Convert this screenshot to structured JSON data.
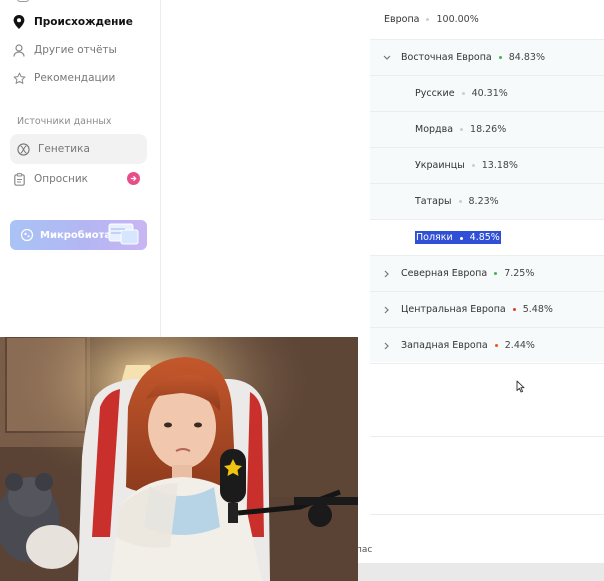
{
  "sidebar": {
    "nav": [
      {
        "label": "Происхождение",
        "icon": "map-pin-icon",
        "active": true
      },
      {
        "label": "Другие отчёты",
        "icon": "person-icon"
      },
      {
        "label": "Рекомендации",
        "icon": "star-icon"
      }
    ],
    "section_label": "Источники данных",
    "sources": [
      {
        "label": "Генетика",
        "icon": "dna-icon",
        "selected": true
      },
      {
        "label": "Опросник",
        "icon": "clipboard-icon"
      }
    ],
    "microbiota_label": "Микробиота"
  },
  "tree": {
    "root": {
      "label": "Европа",
      "value": "100.00%",
      "dot_color": "#cfcfcf"
    },
    "rows": [
      {
        "label": "Восточная Европа",
        "value": "84.83%",
        "dot_color": "#4caf50",
        "expanded": true,
        "level": 0
      },
      {
        "label": "Русские",
        "value": "40.31%",
        "dot_color": "#cfcfcf",
        "level": 1
      },
      {
        "label": "Мордва",
        "value": "18.26%",
        "dot_color": "#cfcfcf",
        "level": 1
      },
      {
        "label": "Украинцы",
        "value": "13.18%",
        "dot_color": "#cfcfcf",
        "level": 1
      },
      {
        "label": "Татары",
        "value": "8.23%",
        "dot_color": "#cfcfcf",
        "level": 1
      },
      {
        "label": "Поляки",
        "value": "4.85%",
        "dot_color": "#cfcfcf",
        "level": 1,
        "highlighted": true
      },
      {
        "label": "Северная Европа",
        "value": "7.25%",
        "dot_color": "#4caf50",
        "expanded": false,
        "level": 0
      },
      {
        "label": "Центральная Европа",
        "value": "5.48%",
        "dot_color": "#e53935",
        "expanded": false,
        "level": 0
      },
      {
        "label": "Западная Европа",
        "value": "2.44%",
        "dot_color": "#f4511e",
        "expanded": false,
        "level": 0
      }
    ]
  },
  "footer": {
    "partial_text": "пас"
  },
  "colors": {
    "accent_pink": "#e84d8a",
    "highlight_blue": "#2f4fd6"
  }
}
